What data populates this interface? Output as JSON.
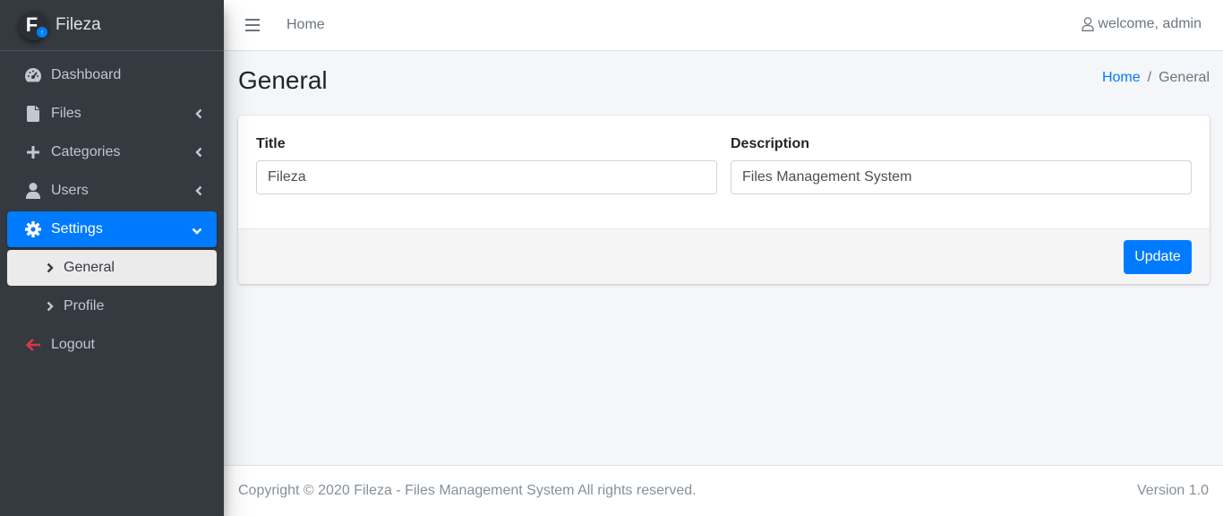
{
  "brand": {
    "name": "Fileza",
    "logo_letter": "F"
  },
  "sidebar": {
    "items": [
      {
        "label": "Dashboard",
        "icon": "dashboard-gauge-icon"
      },
      {
        "label": "Files",
        "icon": "file-icon",
        "has_arrow": true
      },
      {
        "label": "Categories",
        "icon": "plus-icon",
        "has_arrow": true
      },
      {
        "label": "Users",
        "icon": "user-icon",
        "has_arrow": true
      },
      {
        "label": "Settings",
        "icon": "gear-icon",
        "active": true,
        "expanded": true
      },
      {
        "label": "General",
        "icon": "chevron-right-icon",
        "sub": true,
        "current": true
      },
      {
        "label": "Profile",
        "icon": "chevron-right-icon",
        "sub": true
      },
      {
        "label": "Logout",
        "icon": "arrow-left-icon"
      }
    ]
  },
  "header": {
    "home_label": "Home",
    "user_label": "welcome, admin"
  },
  "page": {
    "title": "General",
    "breadcrumb": {
      "home": "Home",
      "separator": "/",
      "current": "General"
    }
  },
  "form": {
    "title_label": "Title",
    "title_value": "Fileza",
    "description_label": "Description",
    "description_value": "Files Management System",
    "update_label": "Update"
  },
  "footer": {
    "copyright": "Copyright © 2020 Fileza - Files Management System All rights reserved.",
    "version": "Version 1.0"
  },
  "colors": {
    "accent": "#007bff",
    "sidebar_bg": "#343a40",
    "logout_icon": "#dc3545"
  }
}
